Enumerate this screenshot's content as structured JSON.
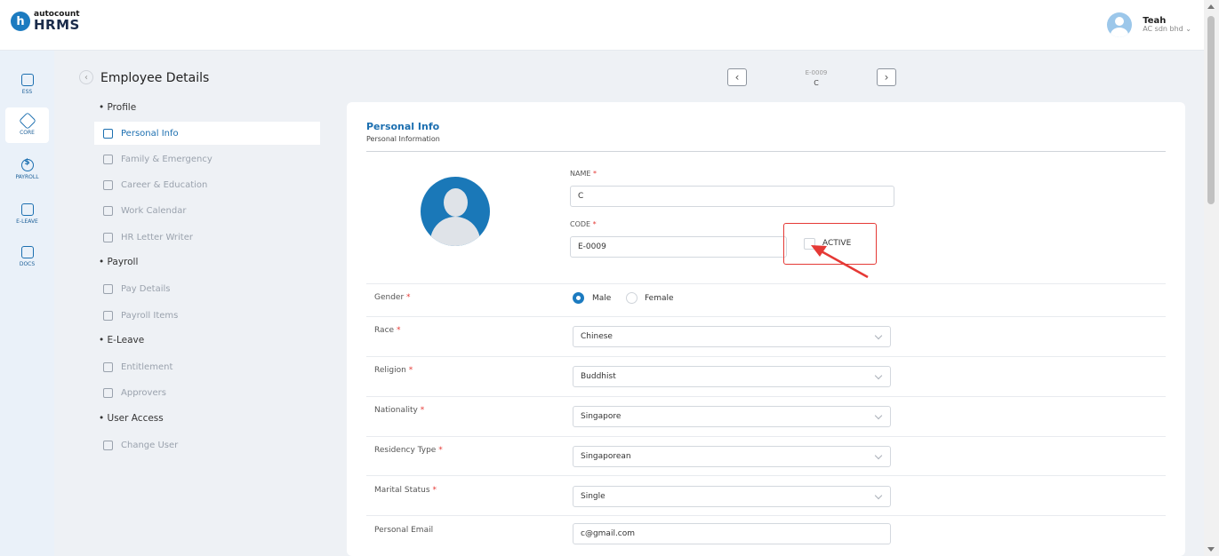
{
  "header": {
    "logo_letter": "h",
    "logo_top": "autocount",
    "logo_bottom": "HRMS",
    "user_name": "Teah",
    "company": "AC sdn bhd"
  },
  "rail": [
    {
      "label": "ESS",
      "icon": "ess-icon"
    },
    {
      "label": "CORE",
      "icon": "core-icon",
      "active": true
    },
    {
      "label": "PAYROLL",
      "icon": "payroll-icon"
    },
    {
      "label": "E-LEAVE",
      "icon": "calendar-icon"
    },
    {
      "label": "DOCS",
      "icon": "docs-icon"
    }
  ],
  "subnav": {
    "title": "Employee Details",
    "groups": [
      {
        "label": "Profile",
        "items": [
          "Personal Info",
          "Family & Emergency",
          "Career & Education",
          "Work Calendar",
          "HR Letter Writer"
        ]
      },
      {
        "label": "Payroll",
        "items": [
          "Pay Details",
          "Payroll Items"
        ]
      },
      {
        "label": "E-Leave",
        "items": [
          "Entitlement",
          "Approvers"
        ]
      },
      {
        "label": "User Access",
        "items": [
          "Change User"
        ]
      }
    ],
    "active_item": "Personal Info"
  },
  "record": {
    "code": "E-0009",
    "name": "C"
  },
  "card": {
    "title": "Personal Info",
    "subtitle": "Personal Information",
    "name_label": "NAME",
    "name_value": "C",
    "code_label": "CODE",
    "code_value": "E-0009",
    "active_label": "ACTIVE",
    "active_checked": false,
    "required_mark": "*"
  },
  "gender": {
    "label": "Gender",
    "options": [
      "Male",
      "Female"
    ],
    "selected": "Male"
  },
  "fields": [
    {
      "label": "Race",
      "value": "Chinese",
      "required": true
    },
    {
      "label": "Religion",
      "value": "Buddhist",
      "required": true
    },
    {
      "label": "Nationality",
      "value": "Singapore",
      "required": true
    },
    {
      "label": "Residency Type",
      "value": "Singaporean",
      "required": true
    },
    {
      "label": "Marital Status",
      "value": "Single",
      "required": true
    }
  ],
  "email": {
    "label": "Personal Email",
    "value": "c@gmail.com"
  },
  "colors": {
    "accent": "#1c7bc0",
    "highlight": "#e53935"
  }
}
